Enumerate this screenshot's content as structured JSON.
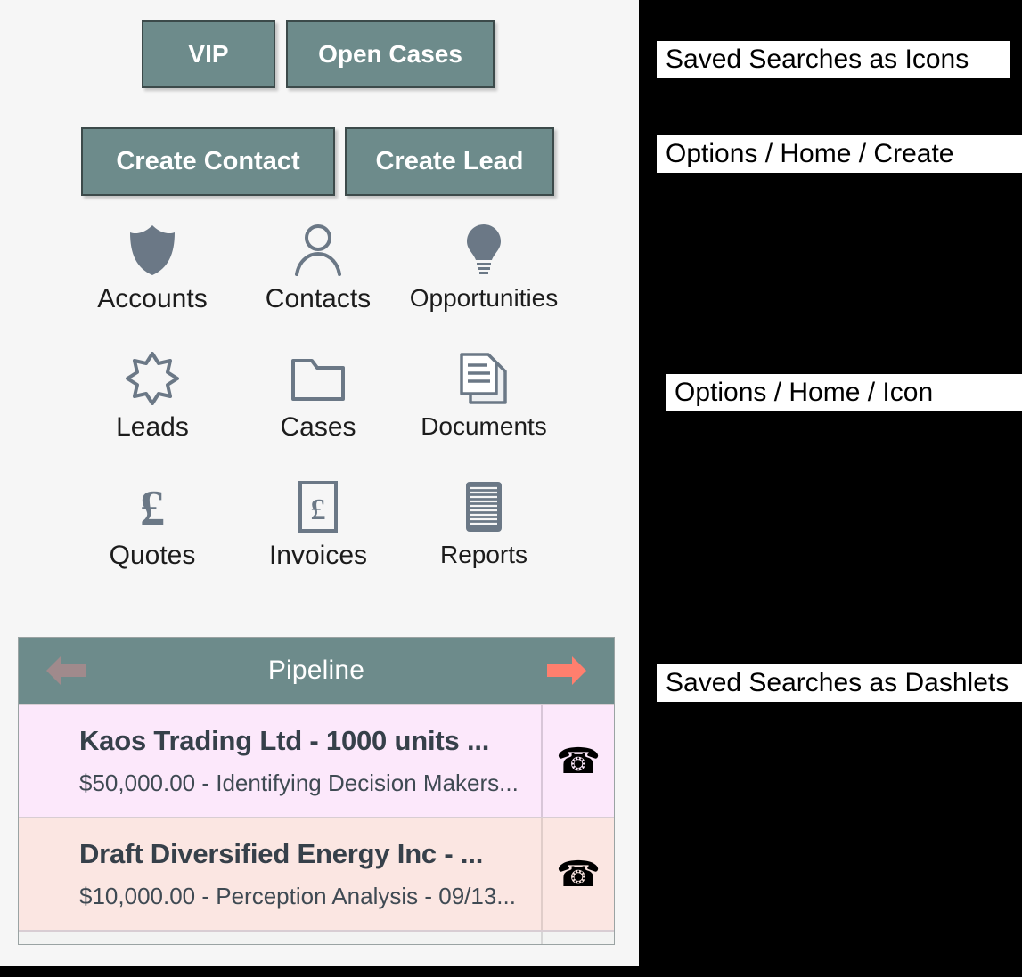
{
  "theme": {
    "accent": "#6d8b8b",
    "accent_border": "#3c4a4a",
    "icon_color": "#6b7886",
    "arrow_next_color": "#ff7f6e",
    "arrow_prev_color": "#a08a8c",
    "panel_bg": "#f6f6f6",
    "annotation_bg": "#000000",
    "row_color_1": "#fce8fb",
    "row_color_2": "#fbe6e2"
  },
  "quick_actions": {
    "saved_searches": [
      {
        "label": "VIP"
      },
      {
        "label": "Open Cases"
      }
    ],
    "create_actions": [
      {
        "label": "Create Contact"
      },
      {
        "label": "Create Lead"
      }
    ]
  },
  "module_icons": [
    {
      "label": "Accounts",
      "icon": "shield-icon"
    },
    {
      "label": "Contacts",
      "icon": "person-icon"
    },
    {
      "label": "Opportunities",
      "icon": "lightbulb-icon"
    },
    {
      "label": "Leads",
      "icon": "starburst-icon"
    },
    {
      "label": "Cases",
      "icon": "folder-icon"
    },
    {
      "label": "Documents",
      "icon": "documents-icon"
    },
    {
      "label": "Quotes",
      "icon": "pound-sign-icon"
    },
    {
      "label": "Invoices",
      "icon": "pound-invoice-icon"
    },
    {
      "label": "Reports",
      "icon": "report-lines-icon"
    }
  ],
  "pipeline": {
    "title": "Pipeline",
    "prev_icon": "arrow-left-icon",
    "next_icon": "arrow-right-icon",
    "rows": [
      {
        "name": "Kaos Trading Ltd - 1000 units ...",
        "detail": "$50,000.00 - Identifying Decision Makers...",
        "action_icon": "phone-icon"
      },
      {
        "name": "Draft Diversified Energy Inc - ...",
        "detail": "$10,000.00 - Perception Analysis - 09/13...",
        "action_icon": "phone-icon"
      }
    ]
  },
  "annotations": [
    {
      "text": "Saved Searches as Icons"
    },
    {
      "text": "Options / Home / Create"
    },
    {
      "text": "Options / Home / Icon"
    },
    {
      "text": "Saved Searches as Dashlets"
    }
  ]
}
